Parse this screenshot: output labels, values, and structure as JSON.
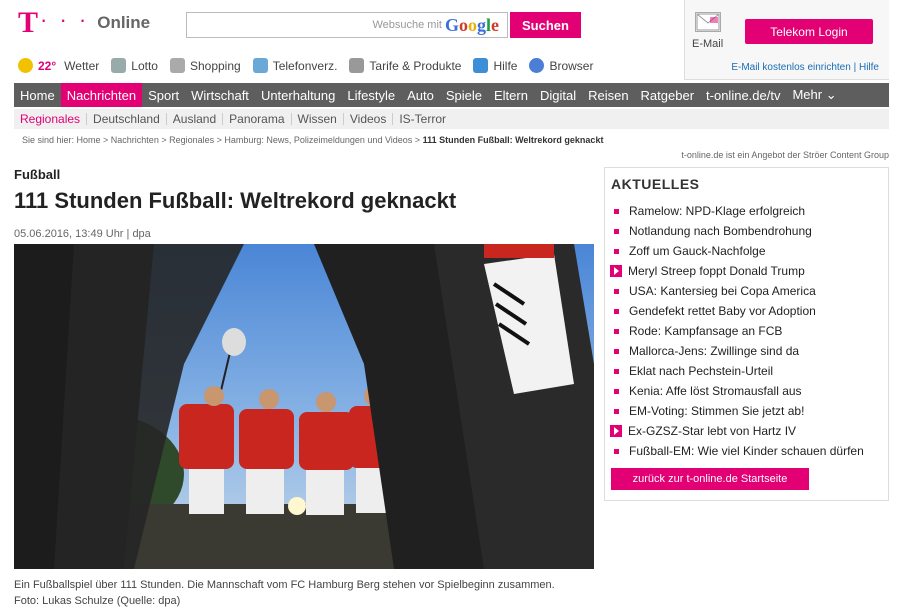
{
  "brand": {
    "logo_t": "T",
    "logo_dots": "· · ·",
    "logo_text": "Online",
    "accent": "#e20074"
  },
  "search": {
    "placeholder": "Websuche mit",
    "engine": "Google",
    "button": "Suchen"
  },
  "quicklinks": [
    {
      "label": "Wetter",
      "temp": "22°",
      "icon": "weather-icon"
    },
    {
      "label": "Lotto",
      "icon": "lotto-icon"
    },
    {
      "label": "Shopping",
      "icon": "cart-icon"
    },
    {
      "label": "Telefonverz.",
      "icon": "phone-icon"
    },
    {
      "label": "Tarife & Produkte",
      "icon": "car-icon"
    },
    {
      "label": "Hilfe",
      "icon": "help-icon"
    },
    {
      "label": "Browser",
      "icon": "browser-icon"
    }
  ],
  "login": {
    "mail_label": "E-Mail",
    "button": "Telekom Login",
    "link1": "E-Mail kostenlos einrichten",
    "link2": "Hilfe"
  },
  "mainnav": [
    "Home",
    "Nachrichten",
    "Sport",
    "Wirtschaft",
    "Unterhaltung",
    "Lifestyle",
    "Auto",
    "Spiele",
    "Eltern",
    "Digital",
    "Reisen",
    "Ratgeber",
    "t-online.de/tv",
    "Mehr ⌄"
  ],
  "mainnav_active": 1,
  "subnav": [
    "Regionales",
    "Deutschland",
    "Ausland",
    "Panorama",
    "Wissen",
    "Videos",
    "IS-Terror"
  ],
  "breadcrumb": {
    "prefix": "Sie sind hier: ",
    "path": "Home > Nachrichten > Regionales > Hamburg: News, Polizeimeldungen und Videos > ",
    "current": "111 Stunden Fußball: Weltrekord geknackt"
  },
  "provider": "t-online.de ist ein Angebot der Ströer Content Group",
  "article": {
    "kicker": "Fußball",
    "headline": "111 Stunden Fußball: Weltrekord geknackt",
    "byline": "05.06.2016, 13:49 Uhr | dpa",
    "caption": "Ein Fußballspiel über 111 Stunden. Die Mannschaft vom FC Hamburg Berg stehen vor Spielbeginn zusammen.",
    "credit": "Foto: Lukas Schulze (Quelle: dpa)"
  },
  "aktuelles": {
    "title": "AKTUELLES",
    "items": [
      {
        "text": "Ramelow: NPD-Klage erfolgreich",
        "video": false
      },
      {
        "text": "Notlandung nach Bombendrohung",
        "video": false
      },
      {
        "text": "Zoff um Gauck-Nachfolge",
        "video": false
      },
      {
        "text": "Meryl Streep foppt Donald Trump",
        "video": true
      },
      {
        "text": "USA: Kantersieg bei Copa America",
        "video": false
      },
      {
        "text": "Gendefekt rettet Baby vor Adoption",
        "video": false
      },
      {
        "text": "Rode: Kampfansage an FCB",
        "video": false
      },
      {
        "text": "Mallorca-Jens: Zwillinge sind da",
        "video": false
      },
      {
        "text": "Eklat nach Pechstein-Urteil",
        "video": false
      },
      {
        "text": "Kenia: Affe löst Stromausfall aus",
        "video": false
      },
      {
        "text": "EM-Voting: Stimmen Sie jetzt ab!",
        "video": false
      },
      {
        "text": "Ex-GZSZ-Star lebt von Hartz IV",
        "video": true
      },
      {
        "text": "Fußball-EM: Wie viel Kinder schauen dürfen",
        "video": false
      }
    ],
    "back_button": "zurück zur t-online.de Startseite"
  }
}
